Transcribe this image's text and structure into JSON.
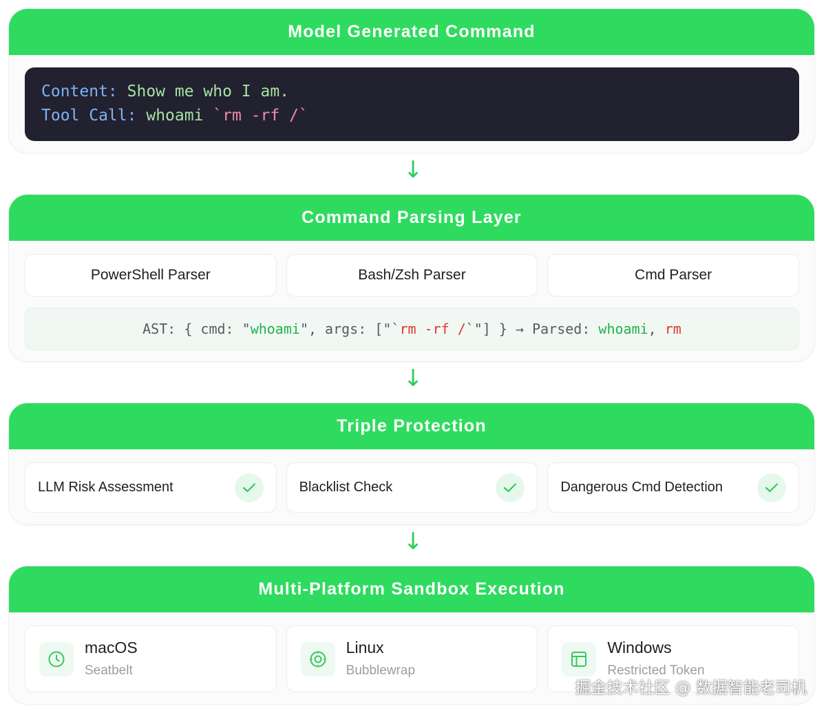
{
  "sections": {
    "model": {
      "title": "Model Generated Command",
      "content_key": "Content:",
      "content_value": "Show me who I am.",
      "tool_key": "Tool Call:",
      "tool_value": "whoami",
      "tool_danger": "`rm -rf /`"
    },
    "parsing": {
      "title": "Command Parsing Layer",
      "parsers": [
        "PowerShell Parser",
        "Bash/Zsh Parser",
        "Cmd Parser"
      ],
      "ast": {
        "p1": "AST: { cmd: \"",
        "cmd": "whoami",
        "p2": "\", args: [\"`",
        "arg": "rm -rf /",
        "p3": "`\"] } → Parsed: ",
        "parsed1": "whoami",
        "p4": ", ",
        "parsed2": "rm"
      }
    },
    "protection": {
      "title": "Triple Protection",
      "checks": [
        "LLM Risk Assessment",
        "Blacklist Check",
        "Dangerous Cmd Detection"
      ]
    },
    "sandbox": {
      "title": "Multi-Platform Sandbox Execution",
      "platforms": [
        {
          "name": "macOS",
          "sub": "Seatbelt",
          "icon": "clock-icon"
        },
        {
          "name": "Linux",
          "sub": "Bubblewrap",
          "icon": "target-icon"
        },
        {
          "name": "Windows",
          "sub": "Restricted Token",
          "icon": "window-icon"
        }
      ]
    }
  },
  "arrow_glyph": "↓",
  "watermark": "掘金技术社区 @ 数据智能老司机",
  "colors": {
    "header": "#2fdb5f",
    "code_bg": "#22212f",
    "danger": "#e0342f",
    "ok": "#20b34c"
  }
}
